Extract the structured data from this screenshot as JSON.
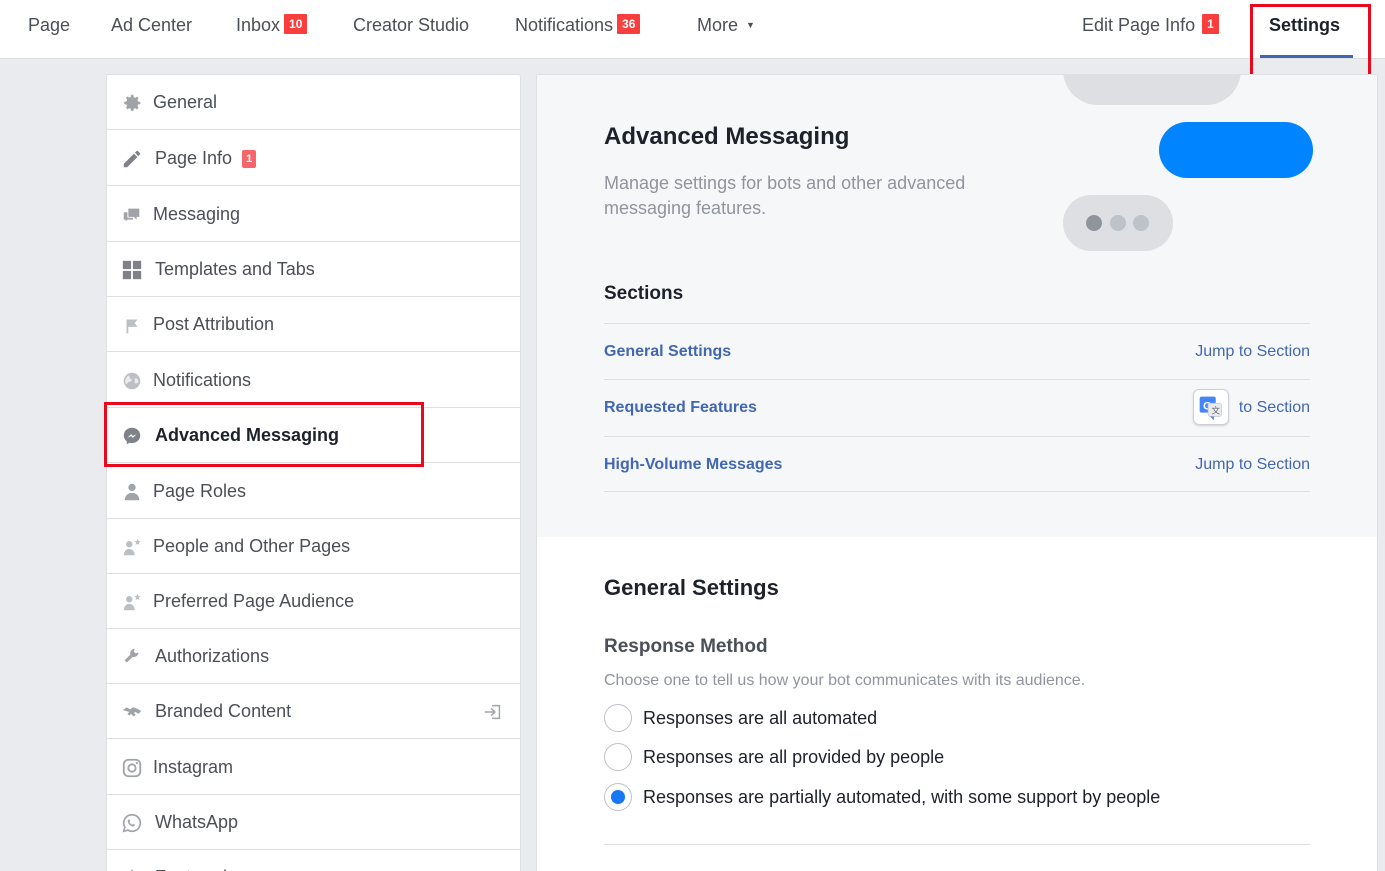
{
  "topnav": {
    "page": "Page",
    "ad_center": "Ad Center",
    "inbox": "Inbox",
    "inbox_badge": "10",
    "creator_studio": "Creator Studio",
    "notifications": "Notifications",
    "notifications_badge": "36",
    "more": "More",
    "edit_page_info": "Edit Page Info",
    "edit_page_info_badge": "1",
    "settings": "Settings"
  },
  "sidebar": {
    "items": [
      {
        "label": "General",
        "icon": "gear-icon"
      },
      {
        "label": "Page Info",
        "icon": "pencil-icon",
        "badge": "1"
      },
      {
        "label": "Messaging",
        "icon": "chat-bubbles-icon"
      },
      {
        "label": "Templates and Tabs",
        "icon": "grid-icon"
      },
      {
        "label": "Post Attribution",
        "icon": "flag-icon"
      },
      {
        "label": "Notifications",
        "icon": "globe-icon"
      },
      {
        "label": "Advanced Messaging",
        "icon": "messenger-icon",
        "active": true
      },
      {
        "label": "Page Roles",
        "icon": "person-icon"
      },
      {
        "label": "People and Other Pages",
        "icon": "person-star-icon"
      },
      {
        "label": "Preferred Page Audience",
        "icon": "person-star-icon"
      },
      {
        "label": "Authorizations",
        "icon": "wrench-icon"
      },
      {
        "label": "Branded Content",
        "icon": "handshake-icon"
      },
      {
        "label": "Instagram",
        "icon": "instagram-icon"
      },
      {
        "label": "WhatsApp",
        "icon": "whatsapp-icon"
      },
      {
        "label": "Featured",
        "icon": "star-icon"
      }
    ]
  },
  "main": {
    "title": "Advanced Messaging",
    "description": "Manage settings for bots and other advanced messaging features.",
    "sections_title": "Sections",
    "sections": [
      {
        "name": "General Settings",
        "jump": "Jump to Section"
      },
      {
        "name": "Requested Features",
        "jump": "to Section"
      },
      {
        "name": "High-Volume Messages",
        "jump": "Jump to Section"
      }
    ],
    "general_settings_title": "General Settings",
    "response_method_title": "Response Method",
    "response_method_desc": "Choose one to tell us how your bot communicates with its audience.",
    "options": [
      {
        "label": "Responses are all automated",
        "selected": false
      },
      {
        "label": "Responses are all provided by people",
        "selected": false
      },
      {
        "label": "Responses are partially automated, with some support by people",
        "selected": true
      }
    ]
  },
  "colors": {
    "accent": "#4267b2",
    "badge_red": "#fa3e3e",
    "messenger_blue": "#0084ff",
    "highlight_red": "#e8091c"
  }
}
